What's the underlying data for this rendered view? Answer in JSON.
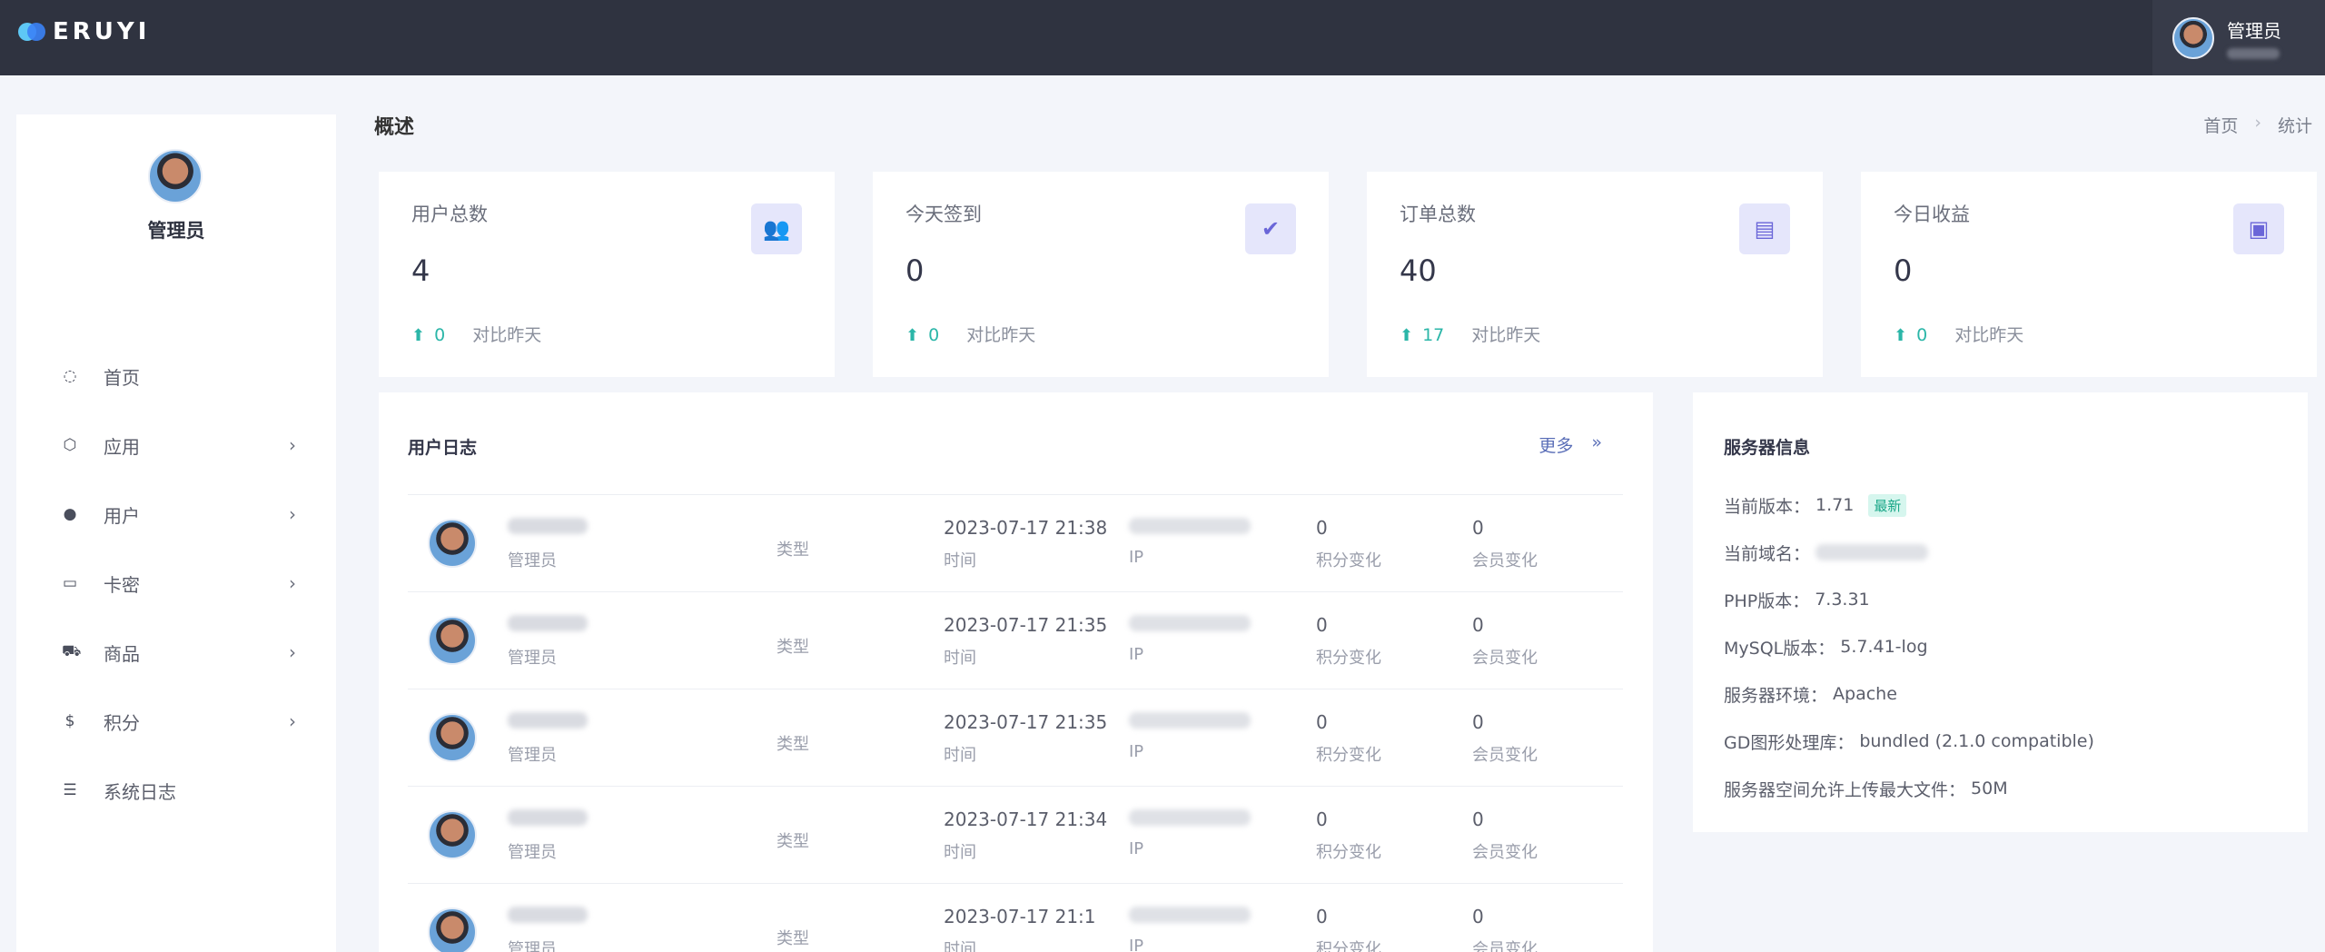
{
  "topbar": {
    "logo_text": "ERUYI",
    "user_name": "管理员"
  },
  "sidebar": {
    "user_name": "管理员",
    "menu": [
      {
        "label": "首页",
        "icon": "home-icon",
        "has_arrow": false
      },
      {
        "label": "应用",
        "icon": "cube-icon",
        "has_arrow": true
      },
      {
        "label": "用户",
        "icon": "user-icon",
        "has_arrow": true
      },
      {
        "label": "卡密",
        "icon": "card-icon",
        "has_arrow": true
      },
      {
        "label": "商品",
        "icon": "cart-icon",
        "has_arrow": true
      },
      {
        "label": "积分",
        "icon": "coin-icon",
        "has_arrow": true
      },
      {
        "label": "系统日志",
        "icon": "log-icon",
        "has_arrow": false
      }
    ]
  },
  "header": {
    "title": "概述",
    "breadcrumb": [
      "首页",
      "统计"
    ]
  },
  "stats": [
    {
      "label": "用户总数",
      "value": "4",
      "delta": "0",
      "compare": "对比昨天",
      "icon": "users-icon"
    },
    {
      "label": "今天签到",
      "value": "0",
      "delta": "0",
      "compare": "对比昨天",
      "icon": "user-check-icon"
    },
    {
      "label": "订单总数",
      "value": "40",
      "delta": "17",
      "compare": "对比昨天",
      "icon": "calendar-icon"
    },
    {
      "label": "今日收益",
      "value": "0",
      "delta": "0",
      "compare": "对比昨天",
      "icon": "money-icon"
    }
  ],
  "logs": {
    "title": "用户日志",
    "more_label": "更多",
    "more_arrow": "»",
    "columns": {
      "type": "类型",
      "time": "时间",
      "ip": "IP",
      "points": "积分变化",
      "member": "会员变化"
    },
    "rows": [
      {
        "role": "管理员",
        "time": "2023-07-17 21:38",
        "points": "0",
        "member": "0"
      },
      {
        "role": "管理员",
        "time": "2023-07-17 21:35",
        "points": "0",
        "member": "0"
      },
      {
        "role": "管理员",
        "time": "2023-07-17 21:35",
        "points": "0",
        "member": "0"
      },
      {
        "role": "管理员",
        "time": "2023-07-17 21:34",
        "points": "0",
        "member": "0"
      },
      {
        "role": "管理员",
        "time": "2023-07-17 21:1",
        "points": "0",
        "member": "0"
      }
    ]
  },
  "server": {
    "title": "服务器信息",
    "rows": [
      {
        "label": "当前版本：",
        "value": "1.71",
        "badge": "最新"
      },
      {
        "label": "当前域名：",
        "value": "",
        "blurred": true
      },
      {
        "label": "PHP版本：",
        "value": "7.3.31"
      },
      {
        "label": "MySQL版本：",
        "value": "5.7.41-log"
      },
      {
        "label": "服务器环境：",
        "value": "Apache"
      },
      {
        "label": "GD图形处理库：",
        "value": "bundled (2.1.0 compatible)"
      },
      {
        "label": "服务器空间允许上传最大文件：",
        "value": "50M"
      }
    ]
  },
  "colors": {
    "topbar": "#2f3340",
    "accent": "#6a66d8",
    "positive": "#2bb6a8",
    "background": "#f3f5fa"
  }
}
